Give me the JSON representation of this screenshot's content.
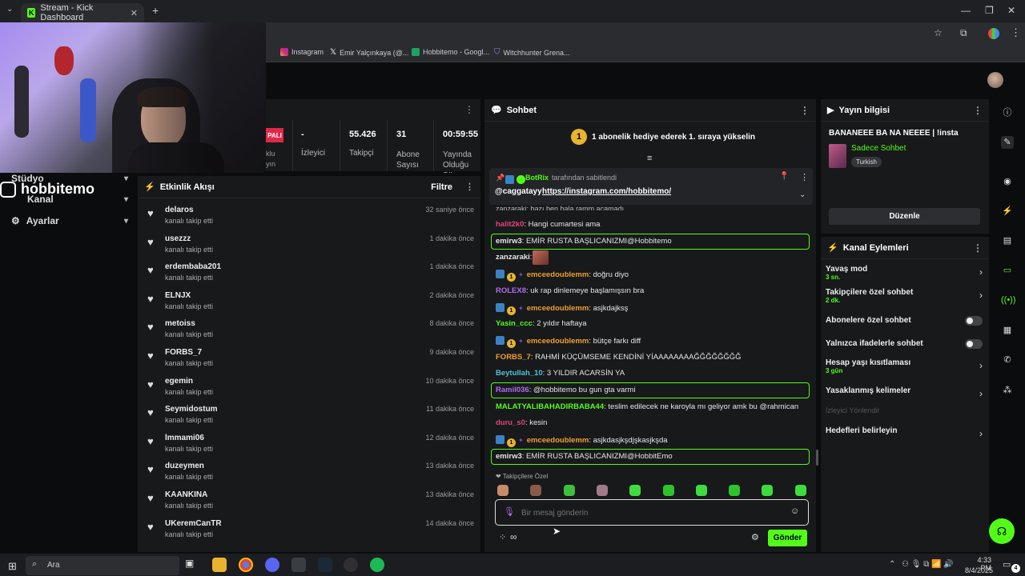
{
  "browser": {
    "tab_title": "Stream - Kick Dashboard",
    "bookmarks": [
      "Instagram",
      "Emir Yalçınkaya (@...",
      "Hobbitemo - Googl...",
      "Witchhunter Grena..."
    ]
  },
  "overlay": {
    "handle": "hobbitemo"
  },
  "nav": {
    "items": [
      "Stüdyo",
      "Kanal",
      "Ayarlar"
    ]
  },
  "stats": {
    "live_badge": "PALI",
    "items": [
      {
        "value": "-",
        "label": "İzleyici"
      },
      {
        "value": "55.426",
        "label": "Takipçi"
      },
      {
        "value": "31",
        "label": "Abone Sayısı"
      },
      {
        "value": "00:59:55",
        "label": "Yayında Olduğu Süre"
      }
    ]
  },
  "activity": {
    "title": "Etkinlik Akışı",
    "filter": "Filtre",
    "events": [
      {
        "name": "delaros",
        "sub": "kanalı takip etti",
        "time": "32 saniye önce"
      },
      {
        "name": "usezzz",
        "sub": "kanalı takip etti",
        "time": "1 dakika önce"
      },
      {
        "name": "erdembaba201",
        "sub": "kanalı takip etti",
        "time": "1 dakika önce"
      },
      {
        "name": "ELNJX",
        "sub": "kanalı takip etti",
        "time": "2 dakika önce"
      },
      {
        "name": "metoiss",
        "sub": "kanalı takip etti",
        "time": "8 dakika önce"
      },
      {
        "name": "FORBS_7",
        "sub": "kanalı takip etti",
        "time": "9 dakika önce"
      },
      {
        "name": "egemin",
        "sub": "kanalı takip etti",
        "time": "10 dakika önce"
      },
      {
        "name": "Seymidostum",
        "sub": "kanalı takip etti",
        "time": "11 dakika önce"
      },
      {
        "name": "lmmami06",
        "sub": "kanalı takip etti",
        "time": "12 dakika önce"
      },
      {
        "name": "duzeymen",
        "sub": "kanalı takip etti",
        "time": "13 dakika önce"
      },
      {
        "name": "KAANKINA",
        "sub": "kanalı takip etti",
        "time": "13 dakika önce"
      },
      {
        "name": "UKeremCanTR",
        "sub": "kanalı takip etti",
        "time": "14 dakika önce"
      }
    ]
  },
  "chat": {
    "title": "Sohbet",
    "promo": "1 abonelik hediye ederek 1. sıraya yükselin",
    "promo_rank": "1",
    "pinned_by": "BotRix",
    "pinned_suffix": "tarafından sabitlendi",
    "pinned_user": "@caggatayy",
    "pinned_link": "https://instagram.com/hobbitemo/",
    "cut_line": "zanzaraki: bazı ben hala ramm açamadı",
    "messages": [
      {
        "user": "halit2k0",
        "color": "#e0457b",
        "text": "Hangi cumartesi ama",
        "hl": false,
        "badges": false
      },
      {
        "user": "emirw3",
        "color": "#e6e6e6",
        "text": "EMİR RUSTA BAŞLICANIZMI@Hobbitemo",
        "hl": true,
        "badges": false
      },
      {
        "user": "zanzaraki",
        "color": "#e6e6e6",
        "text": "",
        "hl": false,
        "badges": false
      },
      {
        "user": "emceedoublemm",
        "color": "#f0a030",
        "text": "doğru diyo",
        "hl": false,
        "badges": true
      },
      {
        "user": "ROLEX8",
        "color": "#b06cf0",
        "text": "uk rap dinlemeye başlamışsın bra",
        "hl": false,
        "badges": false
      },
      {
        "user": "emceedoublemm",
        "color": "#f0a030",
        "text": "asjkdajksş",
        "hl": false,
        "badges": true
      },
      {
        "user": "Yasin_ccc",
        "color": "#53fc18",
        "text": "2 yıldır haftaya",
        "hl": false,
        "badges": false
      },
      {
        "user": "emceedoublemm",
        "color": "#f0a030",
        "text": "bütçe farkı diff",
        "hl": false,
        "badges": true
      },
      {
        "user": "FORBS_7",
        "color": "#f0a030",
        "text": "RAHMİ KÜÇÜMSEME KENDİNİ YİAAAAAAAAĞĞĞĞĞĞĞĞ",
        "hl": false,
        "badges": false
      },
      {
        "user": "Beytullah_10",
        "color": "#4fc3d9",
        "text": "3 YILDIR ACARSİN YA",
        "hl": false,
        "badges": false
      },
      {
        "user": "Ramil036",
        "color": "#b06cf0",
        "text": "@hobbitemo bu gun gta varmi",
        "hl": true,
        "badges": false
      },
      {
        "user": "MALATYALIBAHADIRBABA44",
        "color": "#53fc18",
        "text": "teslim edilecek ne karoyla mı geliyor amk bu @rahmican",
        "hl": false,
        "badges": false
      },
      {
        "user": "duru_s0",
        "color": "#e0457b",
        "text": "kesin",
        "hl": false,
        "badges": false
      },
      {
        "user": "emceedoublemm",
        "color": "#f0a030",
        "text": "asjkdasjkşdjşkasjkşda",
        "hl": false,
        "badges": true
      },
      {
        "user": "emirw3",
        "color": "#e6e6e6",
        "text": "EMİR RUSTA BAŞLICANIZMI@HobbitEmo",
        "hl": true,
        "badges": false
      }
    ],
    "followers_only_label": "Takipçilere Özel",
    "input_placeholder": "Bir mesaj gönderin",
    "send": "Gönder"
  },
  "stream_info": {
    "title": "Yayın bilgisi",
    "stream_title": "BANANEEE BA NA NEEEE | !insta",
    "category": "Sadece Sohbet",
    "tag": "Turkish",
    "edit": "Düzenle"
  },
  "channel_actions": {
    "title": "Kanal Eylemleri",
    "items": [
      {
        "label": "Yavaş mod",
        "sub": "3 sn.",
        "kind": "chevron"
      },
      {
        "label": "Takipçilere özel sohbet",
        "sub": "2 dk.",
        "kind": "chevron"
      },
      {
        "label": "Abonelere özel sohbet",
        "sub": "",
        "kind": "toggle"
      },
      {
        "label": "Yalnızca ifadelerle sohbet",
        "sub": "",
        "kind": "toggle"
      },
      {
        "label": "Hesap yaşı kısıtlaması",
        "sub": "3 gün",
        "kind": "chevron"
      },
      {
        "label": "Yasaklanmış kelimeler",
        "sub": "",
        "kind": "chevron"
      },
      {
        "label": "İzleyici Yönlendir",
        "sub": "",
        "kind": "disabled"
      },
      {
        "label": "Hedefleri belirleyin",
        "sub": "",
        "kind": "chevron"
      }
    ]
  },
  "taskbar": {
    "search": "Ara",
    "time": "4:33 PM",
    "date": "8/4/2025",
    "notif_count": "4"
  },
  "colors": {
    "accent": "#53fc18",
    "panel": "#18191b"
  }
}
